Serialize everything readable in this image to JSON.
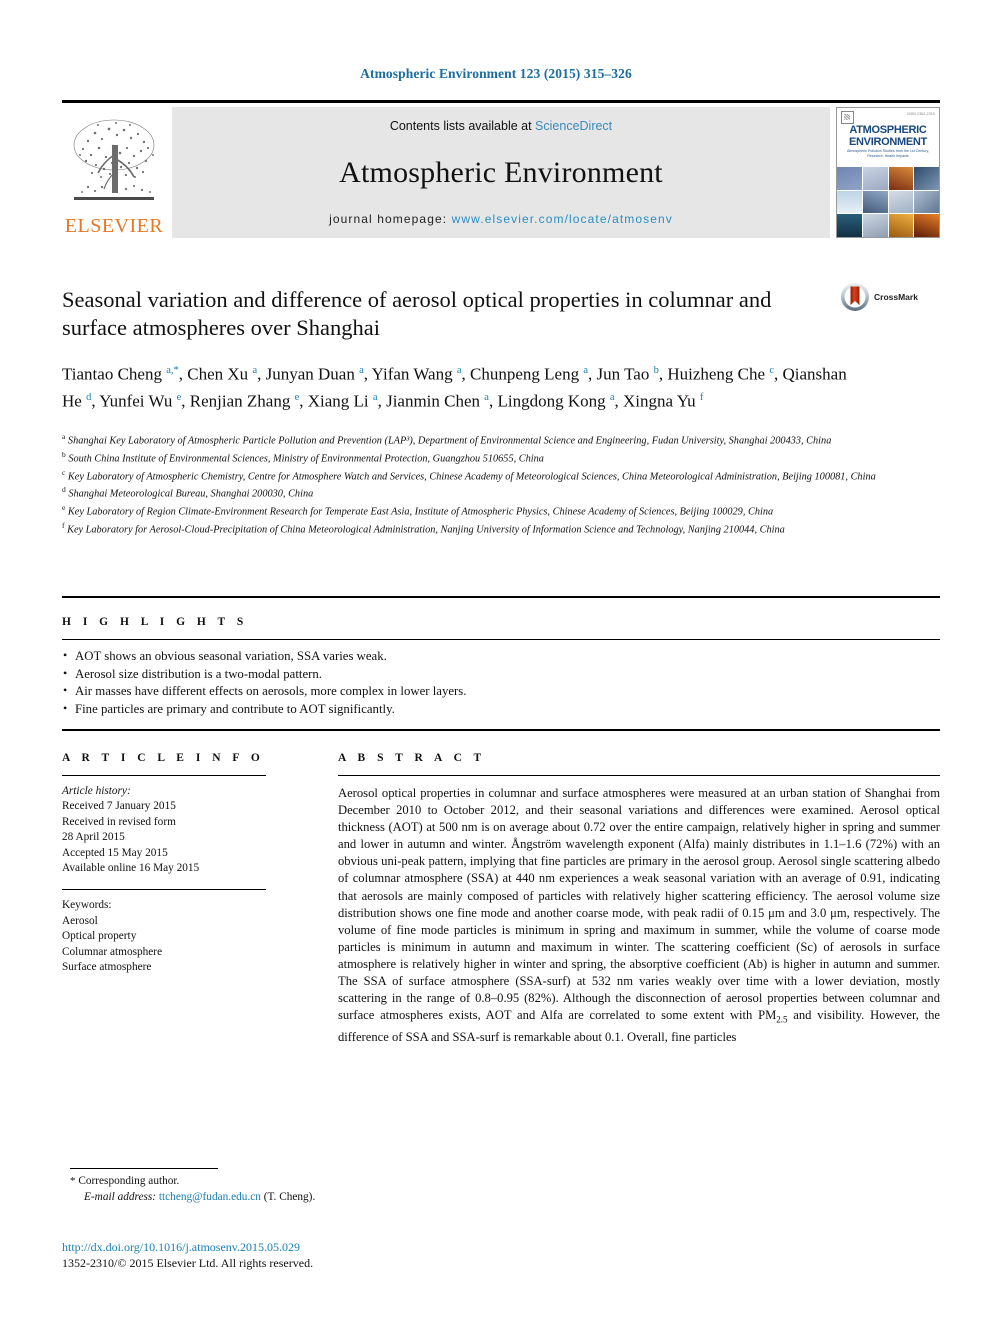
{
  "running_head": "Atmospheric Environment 123 (2015) 315–326",
  "masthead": {
    "publisher_name": "ELSEVIER",
    "contents_prefix": "Contents lists available at ",
    "contents_link": "ScienceDirect",
    "journal_name": "Atmospheric Environment",
    "homepage_prefix": "journal homepage: ",
    "homepage_url": "www.elsevier.com/locate/atmosenv",
    "cover": {
      "title_line1": "ATMOSPHERIC",
      "title_line2": "ENVIRONMENT",
      "subtitle": "Atmospheric Pollution Studies from the 1st Century, Research, Health Impacts",
      "corner_note": "ISSN 1352-2310"
    }
  },
  "article": {
    "title": "Seasonal variation and difference of aerosol optical properties in columnar and surface atmospheres over Shanghai",
    "crossmark_label": "CrossMark",
    "authors": [
      {
        "name": "Tiantao Cheng",
        "marks": "a,*"
      },
      {
        "name": "Chen Xu",
        "marks": "a"
      },
      {
        "name": "Junyan Duan",
        "marks": "a"
      },
      {
        "name": "Yifan Wang",
        "marks": "a"
      },
      {
        "name": "Chunpeng Leng",
        "marks": "a"
      },
      {
        "name": "Jun Tao",
        "marks": "b"
      },
      {
        "name": "Huizheng Che",
        "marks": "c"
      },
      {
        "name": "Qianshan He",
        "marks": "d"
      },
      {
        "name": "Yunfei Wu",
        "marks": "e"
      },
      {
        "name": "Renjian Zhang",
        "marks": "e"
      },
      {
        "name": "Xiang Li",
        "marks": "a"
      },
      {
        "name": "Jianmin Chen",
        "marks": "a"
      },
      {
        "name": "Lingdong Kong",
        "marks": "a"
      },
      {
        "name": "Xingna Yu",
        "marks": "f"
      }
    ],
    "affiliations": [
      {
        "mark": "a",
        "text": "Shanghai Key Laboratory of Atmospheric Particle Pollution and Prevention (LAP³), Department of Environmental Science and Engineering, Fudan University, Shanghai 200433, China"
      },
      {
        "mark": "b",
        "text": "South China Institute of Environmental Sciences, Ministry of Environmental Protection, Guangzhou 510655, China"
      },
      {
        "mark": "c",
        "text": "Key Laboratory of Atmospheric Chemistry, Centre for Atmosphere Watch and Services, Chinese Academy of Meteorological Sciences, China Meteorological Administration, Beijing 100081, China"
      },
      {
        "mark": "d",
        "text": "Shanghai Meteorological Bureau, Shanghai 200030, China"
      },
      {
        "mark": "e",
        "text": "Key Laboratory of Region Climate-Environment Research for Temperate East Asia, Institute of Atmospheric Physics, Chinese Academy of Sciences, Beijing 100029, China"
      },
      {
        "mark": "f",
        "text": "Key Laboratory for Aerosol-Cloud-Precipitation of China Meteorological Administration, Nanjing University of Information Science and Technology, Nanjing 210044, China"
      }
    ]
  },
  "highlights": {
    "heading": "H I G H L I G H T S",
    "items": [
      "AOT shows an obvious seasonal variation, SSA varies weak.",
      "Aerosol size distribution is a two-modal pattern.",
      "Air masses have different effects on aerosols, more complex in lower layers.",
      "Fine particles are primary and contribute to AOT significantly."
    ]
  },
  "article_info": {
    "heading": "A R T I C L E   I N F O",
    "history_label": "Article history:",
    "history_lines": [
      "Received 7 January 2015",
      "Received in revised form",
      "28 April 2015",
      "Accepted 15 May 2015",
      "Available online 16 May 2015"
    ],
    "keywords_label": "Keywords:",
    "keywords": [
      "Aerosol",
      "Optical property",
      "Columnar atmosphere",
      "Surface atmosphere"
    ]
  },
  "abstract": {
    "heading": "A B S T R A C T",
    "text_part1": "Aerosol optical properties in columnar and surface atmospheres were measured at an urban station of Shanghai from December 2010 to October 2012, and their seasonal variations and differences were examined. Aerosol optical thickness (AOT) at 500 nm is on average about 0.72 over the entire campaign, relatively higher in spring and summer and lower in autumn and winter. Ångström wavelength exponent (Alfa) mainly distributes in 1.1–1.6 (72%) with an obvious uni-peak pattern, implying that fine particles are primary in the aerosol group. Aerosol single scattering albedo of columnar atmosphere (SSA) at 440 nm experiences a weak seasonal variation with an average of 0.91, indicating that aerosols are mainly composed of particles with relatively higher scattering efficiency. The aerosol volume size distribution shows one fine mode and another coarse mode, with peak radii of 0.15 μm and 3.0 μm, respectively. The volume of fine mode particles is minimum in spring and maximum in summer, while the volume of coarse mode particles is minimum in autumn and maximum in winter. The scattering coefficient (Sc) of aerosols in surface atmosphere is relatively higher in winter and spring, the absorptive coefficient (Ab) is higher in autumn and summer. The SSA of surface atmosphere (SSA-surf) at 532 nm varies weakly over time with a lower deviation, mostly scattering in the range of 0.8–0.95 (82%). Although the disconnection of aerosol properties between columnar and surface atmospheres exists, AOT and Alfa are correlated to some extent with PM",
    "subscript": "2.5",
    "text_part2": " and visibility. However, the difference of SSA and SSA-surf is remarkable about 0.1. Overall, fine particles"
  },
  "footer": {
    "corresponding_star": "*",
    "corresponding_label": "Corresponding author.",
    "email_label": "E-mail address:",
    "email": "ttcheng@fudan.edu.cn",
    "email_suffix": "(T. Cheng).",
    "doi_url": "http://dx.doi.org/10.1016/j.atmosenv.2015.05.029",
    "copyright": "1352-2310/© 2015 Elsevier Ltd. All rights reserved."
  },
  "colors": {
    "link_blue": "#1a7fb5",
    "header_blue": "#1a6d9e",
    "elsevier_orange": "#E87722",
    "band_gray": "#e6e6e6"
  }
}
